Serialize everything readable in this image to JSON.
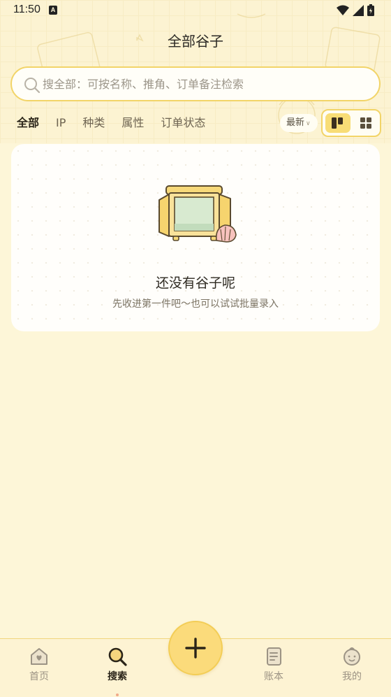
{
  "status_bar": {
    "time": "11:50"
  },
  "page": {
    "title": "全部谷子"
  },
  "search": {
    "placeholder": "搜全部：可按名称、推角、订单备注检索",
    "value": ""
  },
  "filter_tabs": [
    {
      "label": "全部",
      "active": true
    },
    {
      "label": "IP",
      "active": false
    },
    {
      "label": "种类",
      "active": false
    },
    {
      "label": "属性",
      "active": false
    },
    {
      "label": "订单状态",
      "active": false
    }
  ],
  "sort": {
    "label": "最新"
  },
  "view_mode": {
    "options": [
      "board-icon",
      "grid-icon"
    ],
    "selected": "board-icon"
  },
  "empty_state": {
    "title": "还没有谷子呢",
    "subtitle": "先收进第一件吧～也可以试试批量录入",
    "icon": "cabinet-icon"
  },
  "bottom_nav": [
    {
      "label": "首页",
      "icon": "home-icon",
      "active": false
    },
    {
      "label": "搜索",
      "icon": "search-icon",
      "active": true
    },
    {
      "label": "账本",
      "icon": "ledger-icon",
      "active": false
    },
    {
      "label": "我的",
      "icon": "profile-icon",
      "active": false
    }
  ],
  "fab": {
    "icon": "plus-icon"
  },
  "colors": {
    "background": "#fdf6d8",
    "accent": "#f4c531",
    "accent_light": "#fbdb7b",
    "border": "#f2d468",
    "text_primary": "#2e2a22",
    "text_secondary": "#7c7464"
  }
}
